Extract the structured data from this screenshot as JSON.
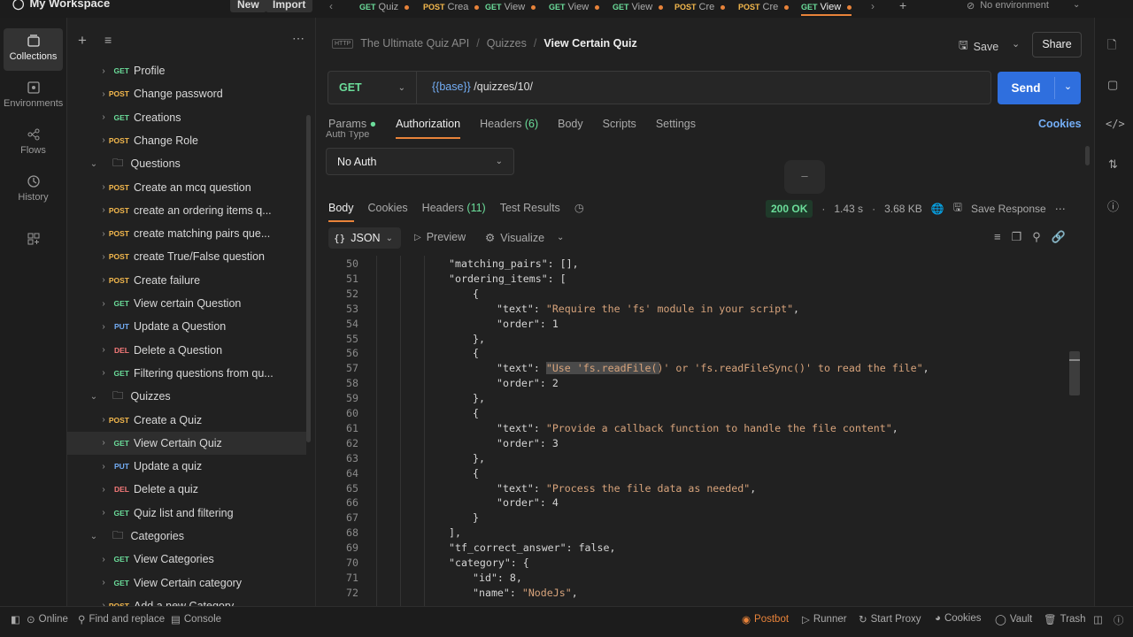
{
  "workspace": {
    "name": "My Workspace",
    "new_label": "New",
    "import_label": "Import"
  },
  "tabs": [
    {
      "method": "GET",
      "label": "Quiz"
    },
    {
      "method": "POST",
      "label": "Crea"
    },
    {
      "method": "GET",
      "label": "View"
    },
    {
      "method": "GET",
      "label": "View"
    },
    {
      "method": "GET",
      "label": "View"
    },
    {
      "method": "POST",
      "label": "Cre"
    },
    {
      "method": "POST",
      "label": "Cre"
    },
    {
      "method": "GET",
      "label": "View"
    }
  ],
  "environment": "No environment",
  "rail": {
    "collections": "Collections",
    "environments": "Environments",
    "flows": "Flows",
    "history": "History"
  },
  "tree": [
    {
      "type": "req",
      "method": "GET",
      "label": "Profile"
    },
    {
      "type": "req",
      "method": "POST",
      "label": "Change password"
    },
    {
      "type": "req",
      "method": "GET",
      "label": "Creations"
    },
    {
      "type": "req",
      "method": "POST",
      "label": "Change Role"
    },
    {
      "type": "folder",
      "label": "Questions"
    },
    {
      "type": "req",
      "method": "POST",
      "label": "Create an mcq question"
    },
    {
      "type": "req",
      "method": "POST",
      "label": "create an ordering items q..."
    },
    {
      "type": "req",
      "method": "POST",
      "label": "create matching pairs que..."
    },
    {
      "type": "req",
      "method": "POST",
      "label": "create True/False question"
    },
    {
      "type": "req",
      "method": "POST",
      "label": "Create failure"
    },
    {
      "type": "req",
      "method": "GET",
      "label": "View certain Question"
    },
    {
      "type": "req",
      "method": "PUT",
      "label": "Update a Question"
    },
    {
      "type": "req",
      "method": "DEL",
      "label": "Delete a Question"
    },
    {
      "type": "req",
      "method": "GET",
      "label": "Filtering questions from qu..."
    },
    {
      "type": "folder",
      "label": "Quizzes"
    },
    {
      "type": "req",
      "method": "POST",
      "label": "Create a Quiz"
    },
    {
      "type": "req",
      "method": "GET",
      "label": "View Certain Quiz",
      "selected": true
    },
    {
      "type": "req",
      "method": "PUT",
      "label": "Update a quiz"
    },
    {
      "type": "req",
      "method": "DEL",
      "label": "Delete a quiz"
    },
    {
      "type": "req",
      "method": "GET",
      "label": "Quiz list and filtering"
    },
    {
      "type": "folder",
      "label": "Categories"
    },
    {
      "type": "req",
      "method": "GET",
      "label": "View Categories"
    },
    {
      "type": "req",
      "method": "GET",
      "label": "View Certain category"
    },
    {
      "type": "req",
      "method": "POST",
      "label": "Add a new Category"
    }
  ],
  "breadcrumb": {
    "badge": "HTTP",
    "collection": "The Ultimate Quiz API",
    "folder": "Quizzes",
    "request": "View Certain Quiz"
  },
  "actions": {
    "save": "Save",
    "share": "Share"
  },
  "request": {
    "method": "GET",
    "url_var": "{{base}}",
    "url_path": " /quizzes/10/",
    "send": "Send"
  },
  "req_tabs": {
    "params": "Params",
    "authorization": "Authorization",
    "headers": "Headers",
    "headers_count": "(6)",
    "body": "Body",
    "scripts": "Scripts",
    "settings": "Settings",
    "cookies": "Cookies"
  },
  "auth": {
    "type_label": "Auth Type",
    "value": "No Auth"
  },
  "resp_tabs": {
    "body": "Body",
    "cookies": "Cookies",
    "headers": "Headers",
    "headers_count": "(11)",
    "tests": "Test Results"
  },
  "resp_meta": {
    "status": "200 OK",
    "time": "1.43 s",
    "size": "3.68 KB",
    "save": "Save Response"
  },
  "resp_toolbar": {
    "format": "JSON",
    "preview": "Preview",
    "visualize": "Visualize"
  },
  "code": [
    {
      "n": "50",
      "i": 3,
      "t": [
        [
          "k",
          "\"matching_pairs\": [],"
        ]
      ]
    },
    {
      "n": "51",
      "i": 3,
      "t": [
        [
          "k",
          "\"ordering_items\": ["
        ]
      ]
    },
    {
      "n": "52",
      "i": 4,
      "t": [
        [
          "k",
          "{"
        ]
      ]
    },
    {
      "n": "53",
      "i": 5,
      "t": [
        [
          "k",
          "\"text\": "
        ],
        [
          "s",
          "\"Require the 'fs' module in your script\""
        ],
        [
          "k",
          ","
        ]
      ]
    },
    {
      "n": "54",
      "i": 5,
      "t": [
        [
          "k",
          "\"order\": 1"
        ]
      ]
    },
    {
      "n": "55",
      "i": 4,
      "t": [
        [
          "k",
          "},"
        ]
      ]
    },
    {
      "n": "56",
      "i": 4,
      "t": [
        [
          "k",
          "{"
        ]
      ]
    },
    {
      "n": "57",
      "i": 5,
      "t": [
        [
          "k",
          "\"text\": "
        ],
        [
          "s",
          "\"Use 'fs.readFile()' or 'fs.readFileSync()' to read the file\""
        ],
        [
          "k",
          ","
        ]
      ],
      "hl": true
    },
    {
      "n": "58",
      "i": 5,
      "t": [
        [
          "k",
          "\"order\": 2"
        ]
      ]
    },
    {
      "n": "59",
      "i": 4,
      "t": [
        [
          "k",
          "},"
        ]
      ]
    },
    {
      "n": "60",
      "i": 4,
      "t": [
        [
          "k",
          "{"
        ]
      ]
    },
    {
      "n": "61",
      "i": 5,
      "t": [
        [
          "k",
          "\"text\": "
        ],
        [
          "s",
          "\"Provide a callback function to handle the file content\""
        ],
        [
          "k",
          ","
        ]
      ]
    },
    {
      "n": "62",
      "i": 5,
      "t": [
        [
          "k",
          "\"order\": 3"
        ]
      ]
    },
    {
      "n": "63",
      "i": 4,
      "t": [
        [
          "k",
          "},"
        ]
      ]
    },
    {
      "n": "64",
      "i": 4,
      "t": [
        [
          "k",
          "{"
        ]
      ]
    },
    {
      "n": "65",
      "i": 5,
      "t": [
        [
          "k",
          "\"text\": "
        ],
        [
          "s",
          "\"Process the file data as needed\""
        ],
        [
          "k",
          ","
        ]
      ]
    },
    {
      "n": "66",
      "i": 5,
      "t": [
        [
          "k",
          "\"order\": 4"
        ]
      ]
    },
    {
      "n": "67",
      "i": 4,
      "t": [
        [
          "k",
          "}"
        ]
      ]
    },
    {
      "n": "68",
      "i": 3,
      "t": [
        [
          "k",
          "],"
        ]
      ]
    },
    {
      "n": "69",
      "i": 3,
      "t": [
        [
          "k",
          "\"tf_correct_answer\": false,"
        ]
      ]
    },
    {
      "n": "70",
      "i": 3,
      "t": [
        [
          "k",
          "\"category\": {"
        ]
      ]
    },
    {
      "n": "71",
      "i": 4,
      "t": [
        [
          "k",
          "\"id\": 8,"
        ]
      ]
    },
    {
      "n": "72",
      "i": 4,
      "t": [
        [
          "k",
          "\"name\": "
        ],
        [
          "s",
          "\"NodeJs\""
        ],
        [
          "k",
          ","
        ]
      ]
    }
  ],
  "status": {
    "online": "Online",
    "find": "Find and replace",
    "console": "Console",
    "postbot": "Postbot",
    "runner": "Runner",
    "proxy": "Start Proxy",
    "cookies": "Cookies",
    "vault": "Vault",
    "trash": "Trash"
  },
  "colors": {
    "accent": "#e8833a",
    "send": "#2f6fde",
    "ok": "#6bdd9a"
  }
}
